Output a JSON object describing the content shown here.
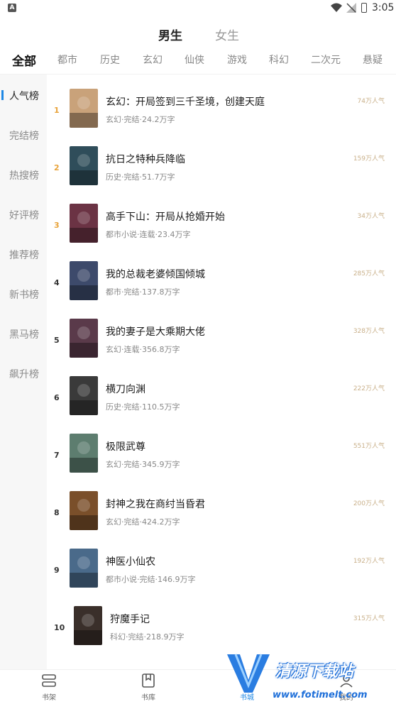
{
  "status_bar": {
    "time": "3:05",
    "notification_icon": "A"
  },
  "gender_tabs": {
    "male": "男生",
    "female": "女生",
    "selected": "male"
  },
  "categories": [
    "全部",
    "都市",
    "历史",
    "玄幻",
    "仙侠",
    "游戏",
    "科幻",
    "二次元",
    "悬疑"
  ],
  "rank_sidebar": [
    "人气榜",
    "完结榜",
    "热搜榜",
    "好评榜",
    "推荐榜",
    "新书榜",
    "黑马榜",
    "飙升榜"
  ],
  "books": [
    {
      "rank": "1",
      "title": "玄幻：开局签到三千圣境，创建天庭",
      "meta": "玄幻·完结·24.2万字",
      "popularity": "74万人气",
      "cover_color": "#c9a27a"
    },
    {
      "rank": "2",
      "title": "抗日之特种兵降临",
      "meta": "历史·完结·51.7万字",
      "popularity": "159万人气",
      "cover_color": "#2f4d5a"
    },
    {
      "rank": "3",
      "title": "高手下山：开局从抢婚开始",
      "meta": "都市小说·连载·23.4万字",
      "popularity": "34万人气",
      "cover_color": "#6b3344"
    },
    {
      "rank": "4",
      "title": "我的总裁老婆倾国倾城",
      "meta": "都市·完结·137.8万字",
      "popularity": "285万人气",
      "cover_color": "#3d4a6b"
    },
    {
      "rank": "5",
      "title": "我的妻子是大乘期大佬",
      "meta": "玄幻·连载·356.8万字",
      "popularity": "328万人气",
      "cover_color": "#5a3a4a"
    },
    {
      "rank": "6",
      "title": "横刀向渊",
      "meta": "历史·完结·110.5万字",
      "popularity": "222万人气",
      "cover_color": "#3a3a3a"
    },
    {
      "rank": "7",
      "title": "极限武尊",
      "meta": "玄幻·完结·345.9万字",
      "popularity": "551万人气",
      "cover_color": "#5d7d6f"
    },
    {
      "rank": "8",
      "title": "封神之我在商纣当昏君",
      "meta": "玄幻·完结·424.2万字",
      "popularity": "200万人气",
      "cover_color": "#7a4f2a"
    },
    {
      "rank": "9",
      "title": "神医小仙农",
      "meta": "都市小说·完结·146.9万字",
      "popularity": "192万人气",
      "cover_color": "#4a6a8a"
    },
    {
      "rank": "10",
      "title": "狩魔手记",
      "meta": "科幻·完结·218.9万字",
      "popularity": "315万人气",
      "cover_color": "#3a2f2a"
    }
  ],
  "bottom_nav": [
    {
      "label": "书架",
      "icon": "bookshelf-icon"
    },
    {
      "label": "书库",
      "icon": "library-icon"
    },
    {
      "label": "书城",
      "icon": "bookstore-icon",
      "active": true
    },
    {
      "label": "我的",
      "icon": "profile-icon"
    }
  ],
  "watermark": {
    "brand": "清源下载站",
    "url": "www.fotimelt.com"
  },
  "colors": {
    "accent": "#1e88e5",
    "top_rank": "#e8a33a",
    "popularity": "#c9b08a"
  }
}
